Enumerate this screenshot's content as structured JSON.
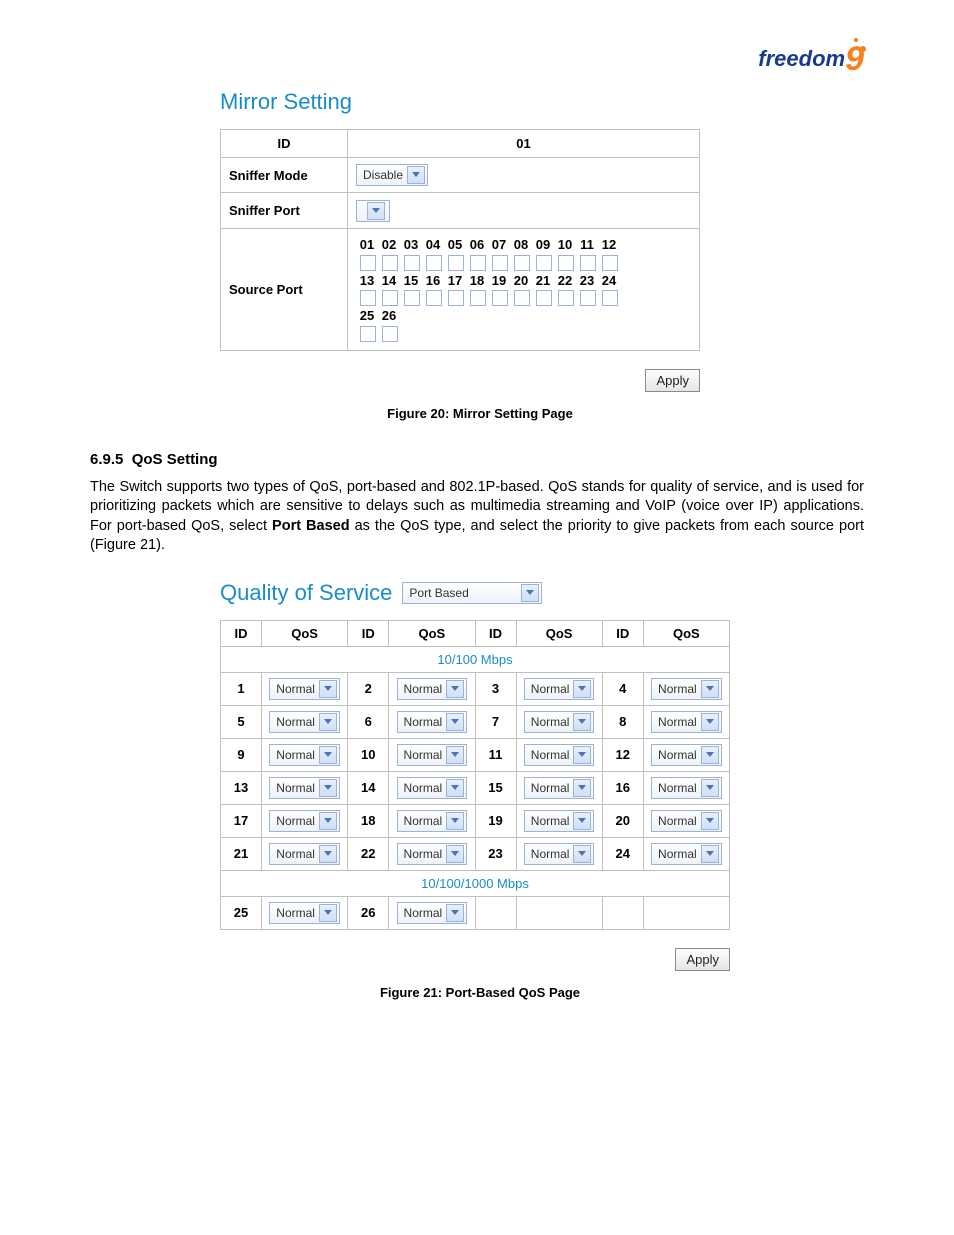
{
  "logo": {
    "text": "freedom",
    "accent": "9"
  },
  "mirror": {
    "title": "Mirror Setting",
    "id_header": "ID",
    "id_value": "01",
    "sniffer_mode_label": "Sniffer Mode",
    "sniffer_mode_value": "Disable",
    "sniffer_port_label": "Sniffer Port",
    "sniffer_port_value": "",
    "source_port_label": "Source Port",
    "port_rows": [
      [
        "01",
        "02",
        "03",
        "04",
        "05",
        "06",
        "07",
        "08",
        "09",
        "10",
        "11",
        "12"
      ],
      [
        "13",
        "14",
        "15",
        "16",
        "17",
        "18",
        "19",
        "20",
        "21",
        "22",
        "23",
        "24"
      ],
      [
        "25",
        "26"
      ]
    ],
    "apply": "Apply",
    "caption": "Figure 20: Mirror Setting Page"
  },
  "section": {
    "number": "6.9.5",
    "title": "QoS Setting",
    "paragraph_a": "The Switch supports two types of QoS, port-based and 802.1P-based.  QoS stands for quality of service, and is used for prioritizing packets which are sensitive to delays such as multimedia streaming and VoIP (voice over IP) applications.  For port-based QoS, select ",
    "paragraph_bold": "Port Based",
    "paragraph_b": " as the QoS type, and select the priority to give packets from each source port (Figure 21)."
  },
  "qos": {
    "title": "Quality of Service",
    "mode": "Port Based",
    "col_id": "ID",
    "col_qos": "QoS",
    "speed1": "10/100 Mbps",
    "speed2": "10/100/1000 Mbps",
    "default_qos": "Normal",
    "rows1": [
      [
        1,
        2,
        3,
        4
      ],
      [
        5,
        6,
        7,
        8
      ],
      [
        9,
        10,
        11,
        12
      ],
      [
        13,
        14,
        15,
        16
      ],
      [
        17,
        18,
        19,
        20
      ],
      [
        21,
        22,
        23,
        24
      ]
    ],
    "rows2": [
      [
        25,
        26
      ]
    ],
    "apply": "Apply",
    "caption": "Figure 21: Port-Based QoS Page"
  }
}
